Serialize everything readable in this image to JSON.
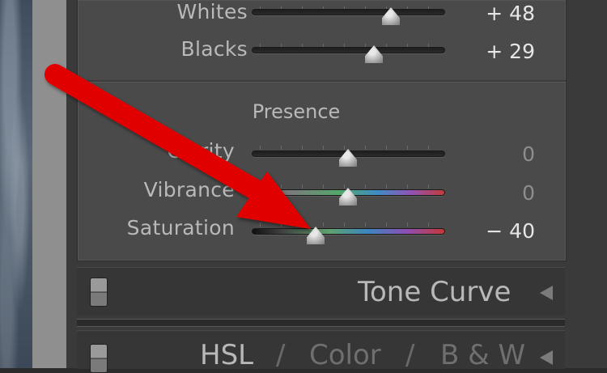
{
  "basic": {
    "sliders": [
      {
        "label": "Whites",
        "value": "+ 48",
        "level": 48
      },
      {
        "label": "Blacks",
        "value": "+ 29",
        "level": 29
      }
    ]
  },
  "presence": {
    "title": "Presence",
    "sliders": [
      {
        "label": "Clarity",
        "value": "0",
        "level": 0
      },
      {
        "label": "Vibrance",
        "value": "0",
        "level": 0
      },
      {
        "label": "Saturation",
        "value": "− 40",
        "level": -40
      }
    ]
  },
  "tone_curve": {
    "title": "Tone Curve"
  },
  "hsl_header": {
    "hsl": "HSL",
    "sep": "/",
    "color": "Color",
    "bw": "B & W"
  },
  "colors": {
    "arrow": "#e00000",
    "panel": "#4a4a4a"
  }
}
